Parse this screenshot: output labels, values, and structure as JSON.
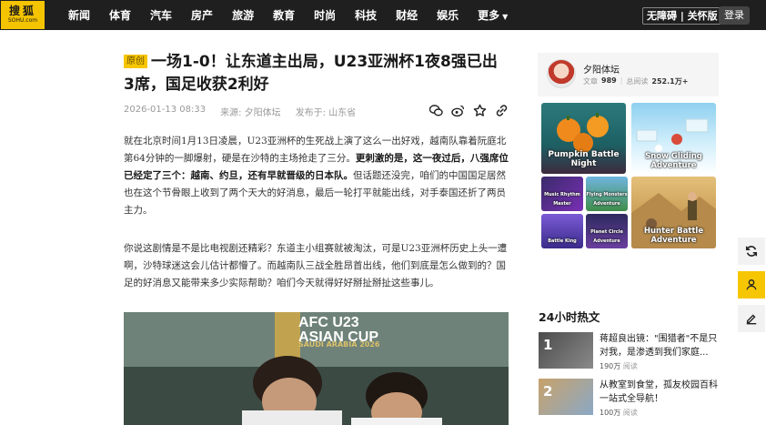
{
  "logo": {
    "line1": "搜狐",
    "line2": "SOHU.com"
  },
  "nav": {
    "items": [
      "新闻",
      "体育",
      "汽车",
      "房产",
      "旅游",
      "教育",
      "时尚",
      "科技",
      "财经",
      "娱乐",
      "更多"
    ],
    "accessibility_label": "无障碍 | 关怀版",
    "login_label": "登录"
  },
  "article": {
    "tag": "原创",
    "title": "一场1-0！让东道主出局，U23亚洲杯1夜8强已出3席，国足收获2利好",
    "date": "2026-01-13 08:33",
    "source": "来源: 夕阳体坛",
    "location": "发布于: 山东省",
    "p1_a": "就在北京时间1月13日凌晨，U23亚洲杯的生死战上演了这么一出好戏，越南队靠着阮庭北第64分钟的一脚爆射，硬是在沙特的主场抢走了三分。",
    "p1_b": "更刺激的是，这一夜过后，八强席位已经定了三个：越南、约旦，还有早就晋级的日本队。",
    "p1_c": "但话题还没完，咱们的中国国足居然也在这个节骨眼上收到了两个天大的好消息，最后一轮打平就能出线，对手泰国还折了两员主力。",
    "p2": "你说这剧情是不是比电视剧还精彩？东道主小组赛就被淘汰，可是U23亚洲杯历史上头一遭啊，沙特球迷这会儿估计都懵了。而越南队三战全胜昂首出线，他们到底是怎么做到的？国足的好消息又能带来多少实际帮助？咱们今天就得好好掰扯掰扯这些事儿。",
    "photo_caption_1": "AFC U23",
    "photo_caption_2": "ASIAN CUP",
    "photo_caption_3": "SAUDI ARABIA 2026"
  },
  "author": {
    "name": "夕阳体坛",
    "articles_label": "文章",
    "articles_count": "989",
    "reads_label": "总阅读",
    "reads_count": "252.1万+"
  },
  "games": [
    {
      "title": "Pumpkin Battle Night"
    },
    {
      "title": "Snow Gliding Adventure"
    },
    {
      "title": "Music Rhythm Master"
    },
    {
      "title": "Flying Monsters Adventure"
    },
    {
      "title": "Battle King"
    },
    {
      "title": "Planet Circle Adventure"
    },
    {
      "title": "Hunter Battle Adventure"
    }
  ],
  "hot": {
    "title": "24小时热文",
    "items": [
      {
        "num": "1",
        "text": "蒋超良出镜：\"围猎者\"不是只对我，是渗透到我们家庭...",
        "views": "190万",
        "views_label": "阅读"
      },
      {
        "num": "2",
        "text": "从教室到食堂，孤友校园百科一站式全导航！",
        "views": "100万",
        "views_label": "阅读"
      }
    ]
  },
  "colors": {
    "brand": "#f6c600",
    "topbar": "#1f1f1f"
  },
  "icons": [
    "wechat-icon",
    "weibo-icon",
    "star-icon",
    "link-icon",
    "refresh-icon",
    "feedback-icon",
    "edit-icon"
  ]
}
